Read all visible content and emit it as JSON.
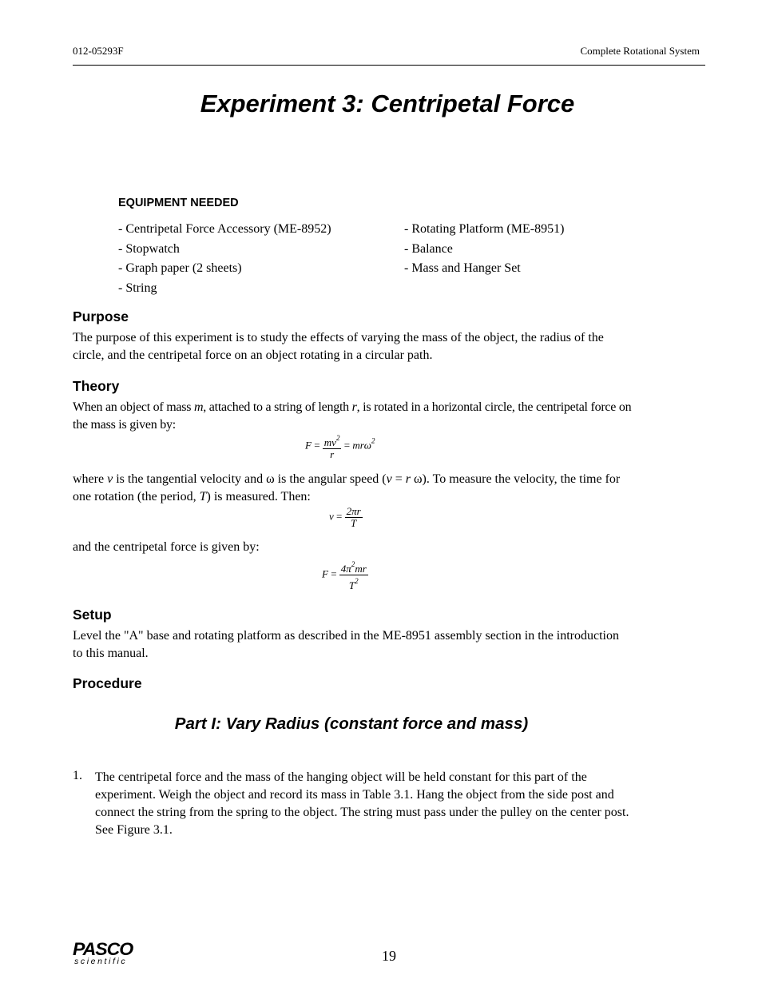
{
  "header": {
    "doc_number": "012-05293F",
    "doc_title": "Complete Rotational System"
  },
  "title": "Experiment 3: Centripetal Force",
  "equipment": {
    "heading": "EQUIPMENT NEEDED",
    "left_items": [
      "- Centripetal Force Accessory (ME-8952)",
      "- Stopwatch",
      "- Graph paper (2 sheets)",
      "- String"
    ],
    "right_items": [
      "- Rotating Platform (ME-8951)",
      "- Balance",
      "- Mass and Hanger Set"
    ]
  },
  "purpose": {
    "heading": "Purpose",
    "text": "The purpose of this experiment is to study the effects of varying the mass of the object, the radius of the circle, and the centripetal force on an object rotating in a circular path."
  },
  "theory": {
    "heading": "Theory",
    "p1_a": "When an object of mass ",
    "p1_m": "m",
    "p1_b": ", attached to a string of length ",
    "p1_r": "r",
    "p1_c": ", is rotated in a horizontal circle, the centripetal force on the mass is given by:",
    "eq1": {
      "lhs": "F",
      "eq": "=",
      "num": "mv",
      "num_exp": "2",
      "den": "r",
      "eq2": "=",
      "rhs": "mrω",
      "rhs_exp": "2"
    },
    "p2_a": "where ",
    "p2_v": "v",
    "p2_b": " is the tangential velocity and ω is the angular speed (",
    "p2_v2": "v",
    "p2_c": " = ",
    "p2_r": "r",
    "p2_d": " ω). To measure the velocity, the time for one rotation (the period, ",
    "p2_T": "T",
    "p2_e": ") is measured. Then:",
    "eq2": {
      "lhs": "v",
      "eq": "=",
      "num": "2πr",
      "den": "T"
    },
    "p3": " and the centripetal force is given by:",
    "eq3": {
      "lhs": "F",
      "eq": "=",
      "num_a": "4π",
      "num_exp": "2",
      "num_b": "mr",
      "den": "T",
      "den_exp": "2"
    }
  },
  "setup": {
    "heading": "Setup",
    "text": "Level the \"A\" base and rotating platform as described in the ME-8951 assembly section in the introduction to this manual."
  },
  "procedure": {
    "heading": "Procedure",
    "part_title": "Part I: Vary Radius (constant force and mass)",
    "steps": [
      {
        "num": "1.",
        "text": "The centripetal force and the mass of the hanging object will be held constant for this part of the experiment. Weigh the object and record its mass in Table 3.1. Hang the object from the side post and connect the string from the spring to the object. The string must pass under the pulley on the center post. See Figure 3.1."
      }
    ]
  },
  "footer": {
    "logo_main": "PASCO",
    "logo_sub": "scientific",
    "page_number": "19"
  }
}
